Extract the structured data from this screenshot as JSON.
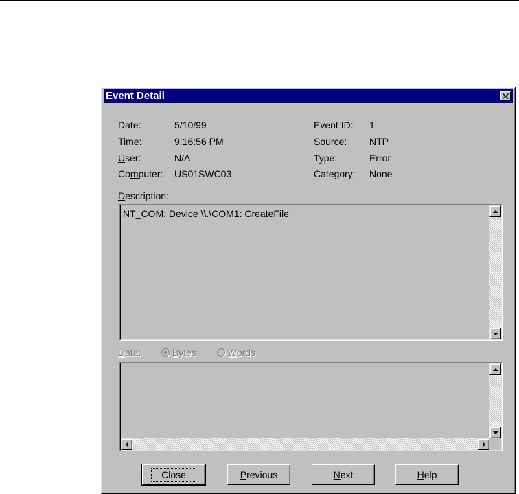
{
  "window": {
    "title": "Event Detail"
  },
  "fields": {
    "date": {
      "label": "Date:",
      "value": "5/10/99"
    },
    "time": {
      "label": "Time:",
      "value": "9:16:56 PM"
    },
    "user": {
      "label_pre": "",
      "label_key": "U",
      "label_post": "ser:",
      "value": "N/A"
    },
    "computer": {
      "label_pre": "Co",
      "label_key": "m",
      "label_post": "puter:",
      "value": "US01SWC03"
    },
    "event_id": {
      "label": "Event ID:",
      "value": "1"
    },
    "source": {
      "label": "Source:",
      "value": "NTP"
    },
    "type": {
      "label": "Type:",
      "value": "Error"
    },
    "category": {
      "label": "Category:",
      "value": "None"
    }
  },
  "description": {
    "label_key": "D",
    "label_post": "escription:",
    "text": "NT_COM: Device \\\\.\\COM1: CreateFile"
  },
  "data_section": {
    "label_key": "D",
    "label_post": "ata:",
    "bytes_key": "B",
    "bytes_post": "ytes",
    "words_key": "W",
    "words_post": "ords"
  },
  "buttons": {
    "close": "Close",
    "previous_key": "P",
    "previous_post": "revious",
    "next_key": "N",
    "next_post": "ext",
    "help_key": "H",
    "help_post": "elp"
  }
}
